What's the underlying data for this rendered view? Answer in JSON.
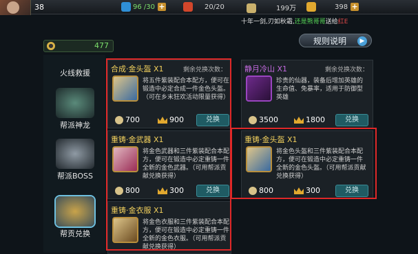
{
  "topbar": {
    "level": "38",
    "stamina": "96 /30",
    "energy": "20/20",
    "silver": "199万",
    "gold": "398"
  },
  "marquee": {
    "part1": "十年一剑,刃如秋霜,",
    "part2": "还是熊哥哥",
    "part3": "送给",
    "part4": "红E"
  },
  "coin_balance": "477",
  "rule_button": "规则说明",
  "sidebar": {
    "items": [
      {
        "label": "火线救援"
      },
      {
        "label": "帮派神龙"
      },
      {
        "label": "帮派BOSS"
      },
      {
        "label": "帮贡兑换"
      }
    ]
  },
  "cards": [
    {
      "title": "合成·金头盔 X1",
      "remain": "剩余兑换次数：",
      "desc": "将五件紫装配合本配方，便可在锻造中必定合成一件金色头盔。（可在乡末狂欢活动限量获得）",
      "coin": "700",
      "gold": "900",
      "btn": "兑换"
    },
    {
      "title": "静月冷山 X1",
      "remain": "剩余兑换次数：",
      "desc": "珍贵的仙器，装备后增加英雄的生命值、免暴率，适用于防御型英雄",
      "coin": "3500",
      "gold": "1800",
      "btn": "兑换"
    },
    {
      "title": "重铸·金武器 X1",
      "desc": "将金色武器和三件紫装配合本配方，便可在锻造中必定重铸一件全新的金色武器。（可用帮派贡献兑换获得）",
      "coin": "800",
      "gold": "300",
      "btn": "兑换"
    },
    {
      "title": "重铸·金头盔 X1",
      "desc": "将金色头盔和三件紫装配合本配方，便可在锻造中必定重铸一件全新的金色头盔。（可用帮派贡献兑换获得）",
      "coin": "800",
      "gold": "300",
      "btn": "兑换"
    },
    {
      "title": "重铸·金衣服 X1",
      "desc": "将金色衣服和三件紫装配合本配方，便可在锻造中必定重铸一件全新的金色衣服。（可用帮派贡献兑换获得）"
    }
  ],
  "colors": {
    "highlight": "#e02828",
    "title_gold": "#f3d15d",
    "title_purple": "#c46ae0"
  }
}
